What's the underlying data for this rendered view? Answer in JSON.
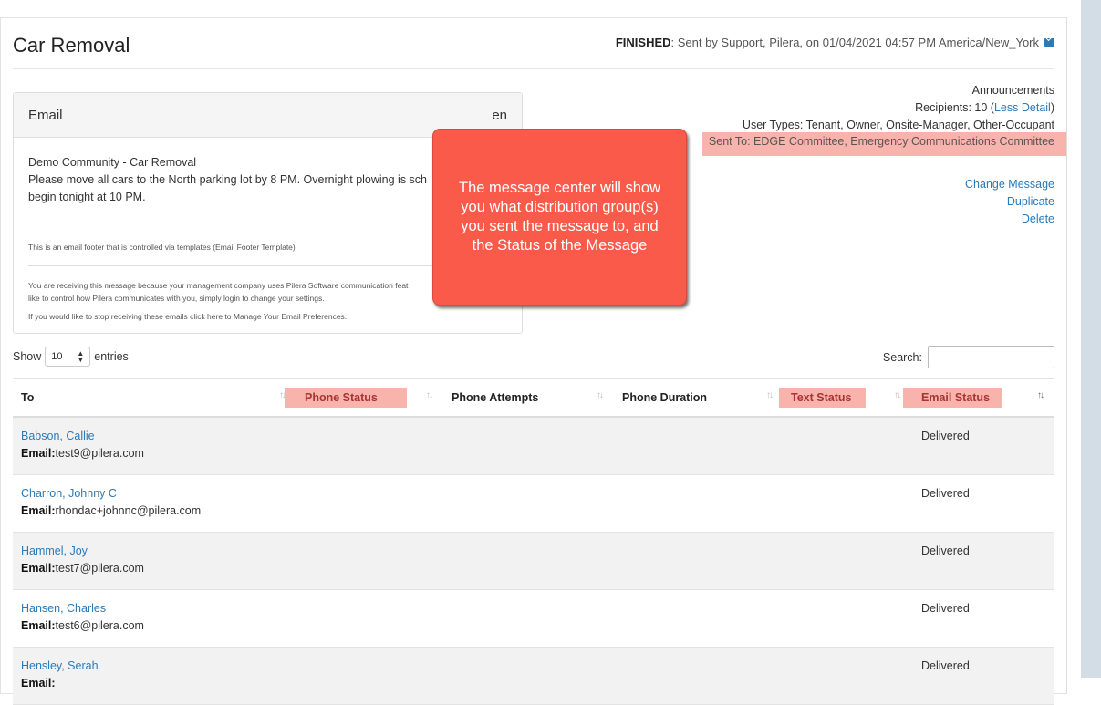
{
  "page": {
    "title": "Car Removal",
    "status_label": "FINISHED",
    "status_detail": ": Sent by Support, Pilera, on 01/04/2021 04:57 PM America/New_York"
  },
  "email_panel": {
    "header": "Email",
    "language": "en",
    "body_lines": [
      "Demo Community - Car Removal",
      "Please move all cars to the North parking lot by 8 PM. Overnight plowing is sch",
      "begin tonight at 10 PM."
    ],
    "footer_template_note": "This is an email footer that is controlled via templates (Email Footer Template)",
    "footer_lines": [
      "You are receiving this message because your management company uses Pilera Software communication feat",
      "like to control how Pilera communicates with you, simply login to change your settings.",
      "If you would like to stop receiving these emails click here to Manage Your Email Preferences."
    ]
  },
  "meta": {
    "category": "Announcements",
    "recipients_prefix": "Recipients: 10 (",
    "recipients_link": "Less Detail",
    "recipients_suffix": ")",
    "user_types": "User Types: Tenant, Owner, Onsite-Manager, Other-Occupant",
    "sent_to": "Sent To: EDGE Committee, Emergency Communications Committee"
  },
  "actions": {
    "change_message": "Change Message",
    "duplicate": "Duplicate",
    "delete": "Delete"
  },
  "callout": {
    "text": "The message center will show you what distribution group(s) you sent the message to, and the Status of the Message"
  },
  "table_controls": {
    "show_label": "Show",
    "entries_value": "10",
    "entries_label": "entries",
    "search_label": "Search:",
    "search_value": ""
  },
  "table": {
    "columns": {
      "to": "To",
      "phone_status": "Phone Status",
      "phone_attempts": "Phone Attempts",
      "phone_duration": "Phone Duration",
      "text_status": "Text Status",
      "email_status": "Email Status"
    },
    "email_prefix": "Email:",
    "rows": [
      {
        "name": "Babson, Callie",
        "email": "test9@pilera.com",
        "email_status": "Delivered"
      },
      {
        "name": "Charron, Johnny C",
        "email": "rhondac+johnnc@pilera.com",
        "email_status": "Delivered"
      },
      {
        "name": "Hammel, Joy",
        "email": "test7@pilera.com",
        "email_status": "Delivered"
      },
      {
        "name": "Hansen, Charles",
        "email": "test6@pilera.com",
        "email_status": "Delivered"
      },
      {
        "name": "Hensley, Serah",
        "email": "",
        "email_status": "Delivered"
      }
    ]
  },
  "colors": {
    "link": "#2a7ab8",
    "callout": "#fa5a4a",
    "highlight": "#f8b4ac"
  }
}
